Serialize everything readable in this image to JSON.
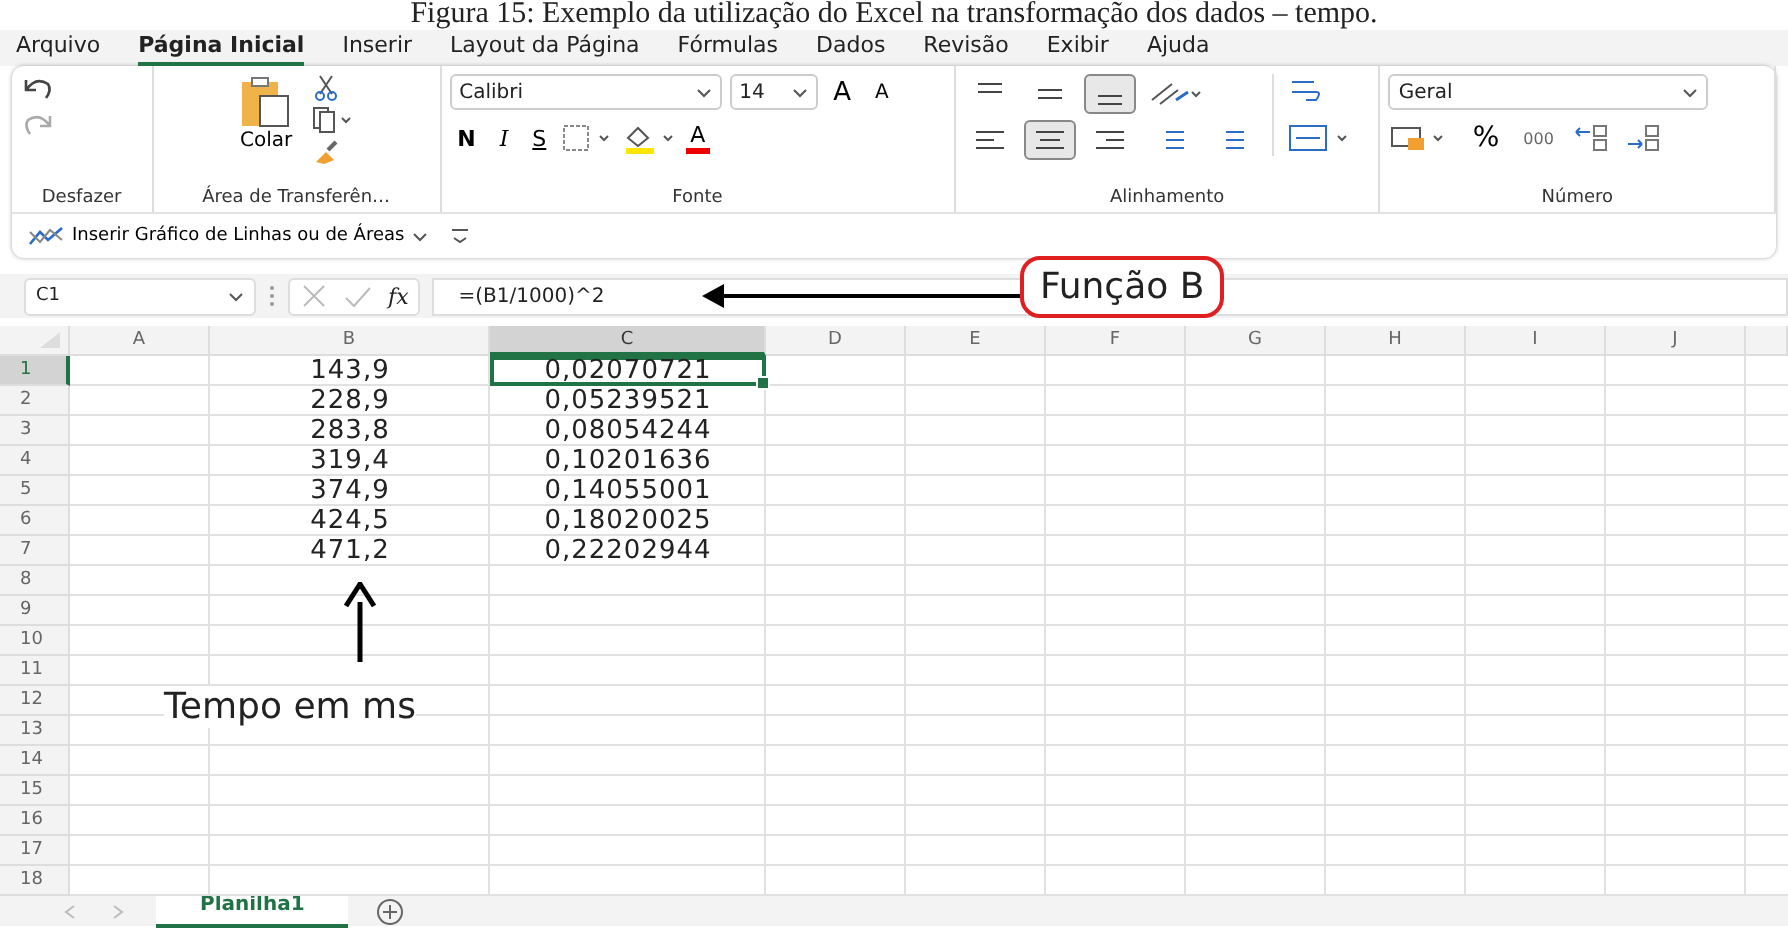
{
  "caption": "Figura 15: Exemplo da utilização do Excel na transformação dos dados – tempo.",
  "menu_tabs": [
    {
      "label": "Arquivo",
      "selected": false
    },
    {
      "label": "Página Inicial",
      "selected": true
    },
    {
      "label": "Inserir",
      "selected": false
    },
    {
      "label": "Layout da Página",
      "selected": false
    },
    {
      "label": "Fórmulas",
      "selected": false
    },
    {
      "label": "Dados",
      "selected": false
    },
    {
      "label": "Revisão",
      "selected": false
    },
    {
      "label": "Exibir",
      "selected": false
    },
    {
      "label": "Ajuda",
      "selected": false
    }
  ],
  "ribbon": {
    "groups": [
      {
        "kind": "undo",
        "label": "Desfazer"
      },
      {
        "kind": "clipboard",
        "label": "Área de Transferên…",
        "paste": "Colar"
      },
      {
        "kind": "font",
        "label": "Fonte",
        "font": "Calibri",
        "size": "14",
        "grow": "A",
        "shrink": "A",
        "styles": [
          "N",
          "I",
          "S"
        ],
        "font_color": "A"
      },
      {
        "kind": "alignment",
        "label": "Alinhamento"
      },
      {
        "kind": "number",
        "label": "Número",
        "format": "Geral",
        "percent": "%",
        "thousands": "000"
      }
    ],
    "quick_action": "Inserir Gráfico de Linhas ou de Áreas"
  },
  "formula_bar": {
    "name_box": "C1",
    "fx": "fx",
    "formula": "=(B1/1000)^2"
  },
  "sheet": {
    "columns": [
      {
        "label": "A",
        "selected": false
      },
      {
        "label": "B",
        "selected": false
      },
      {
        "label": "C",
        "selected": true
      },
      {
        "label": "D",
        "selected": false
      },
      {
        "label": "E",
        "selected": false
      },
      {
        "label": "F",
        "selected": false
      },
      {
        "label": "G",
        "selected": false
      },
      {
        "label": "H",
        "selected": false
      },
      {
        "label": "I",
        "selected": false
      },
      {
        "label": "J",
        "selected": false
      }
    ],
    "rows": [
      {
        "number": "1",
        "selected": true,
        "b": "143,9",
        "c": "0,02070721"
      },
      {
        "number": "2",
        "selected": false,
        "b": "228,9",
        "c": "0,05239521"
      },
      {
        "number": "3",
        "selected": false,
        "b": "283,8",
        "c": "0,08054244"
      },
      {
        "number": "4",
        "selected": false,
        "b": "319,4",
        "c": "0,10201636"
      },
      {
        "number": "5",
        "selected": false,
        "b": "374,9",
        "c": "0,14055001"
      },
      {
        "number": "6",
        "selected": false,
        "b": "424,5",
        "c": "0,18020025"
      },
      {
        "number": "7",
        "selected": false,
        "b": "471,2",
        "c": "0,22202944"
      },
      {
        "number": "8",
        "selected": false
      },
      {
        "number": "9",
        "selected": false
      },
      {
        "number": "10",
        "selected": false
      },
      {
        "number": "11",
        "selected": false
      },
      {
        "number": "12",
        "selected": false
      },
      {
        "number": "13",
        "selected": false
      },
      {
        "number": "14",
        "selected": false
      },
      {
        "number": "15",
        "selected": false
      },
      {
        "number": "16",
        "selected": false
      },
      {
        "number": "17",
        "selected": false
      },
      {
        "number": "18",
        "selected": false
      }
    ]
  },
  "sheet_tabs": [
    {
      "label": "Planilha1",
      "selected": true
    }
  ],
  "annotations": {
    "formula_label": "Função B",
    "column_label": "Tempo em ms"
  }
}
